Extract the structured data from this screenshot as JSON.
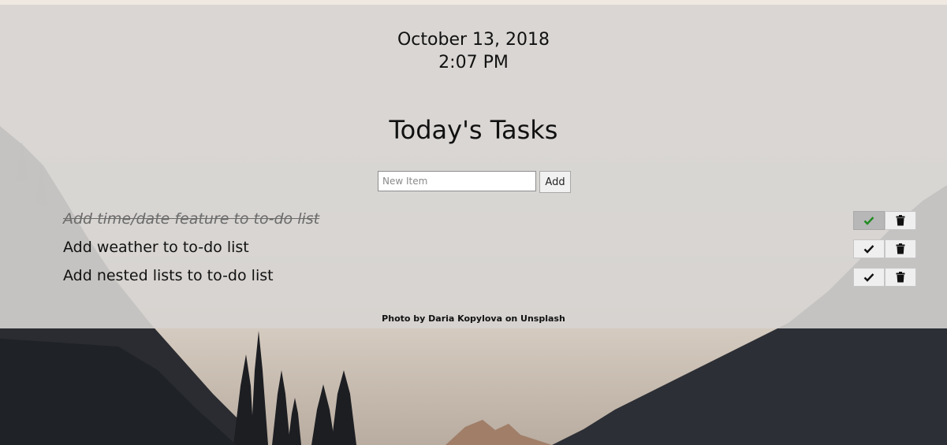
{
  "datetime": {
    "date": "October 13, 2018",
    "time": "2:07 PM"
  },
  "page_title": "Today's Tasks",
  "add_form": {
    "placeholder": "New Item",
    "value": "",
    "add_label": "Add"
  },
  "tasks": [
    {
      "text": "Add time/date feature to to-do list",
      "completed": true,
      "check_icon": "check-icon",
      "delete_icon": "trash-icon"
    },
    {
      "text": "Add weather to to-do list",
      "completed": false,
      "check_icon": "check-icon",
      "delete_icon": "trash-icon"
    },
    {
      "text": "Add nested lists to to-do list",
      "completed": false,
      "check_icon": "check-icon",
      "delete_icon": "trash-icon"
    }
  ],
  "credit": "Photo by Daria Kopylova on Unsplash",
  "colors": {
    "check_completed": "#1f8b1f",
    "check_default": "#111111",
    "overlay": "#d6d4d2"
  }
}
